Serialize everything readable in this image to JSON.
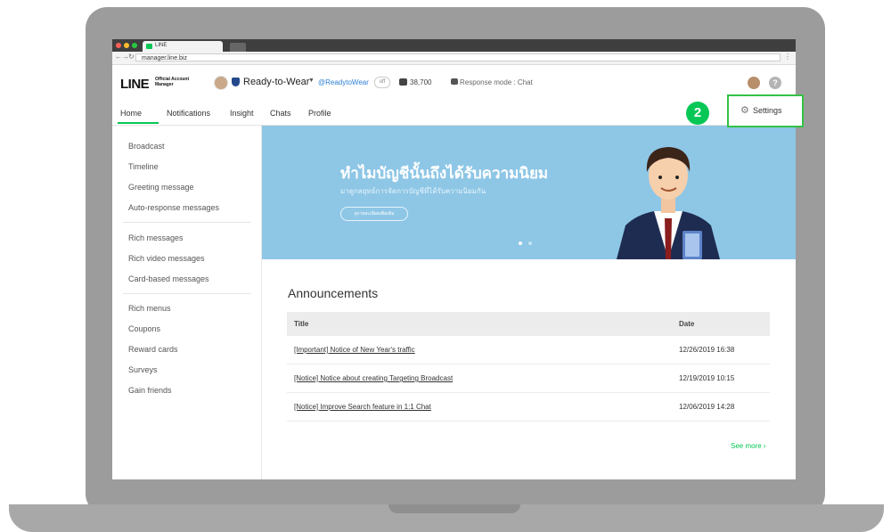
{
  "browser": {
    "tab_title": "LINE",
    "url": "manager.line.biz"
  },
  "header": {
    "logo": "LINE",
    "logo_sub": "Official Account Manager",
    "account_name": "Ready-to-Wear",
    "account_id": "@ReadytoWear",
    "account_pill": "off",
    "friends_count": "38,700",
    "response_mode": "Response mode : Chat",
    "help": "?"
  },
  "nav": {
    "home": "Home",
    "notifications": "Notifications",
    "insight": "Insight",
    "chats": "Chats",
    "profile": "Profile",
    "settings": "Settings"
  },
  "callout": {
    "step": "2"
  },
  "sidebar": {
    "items": [
      "Broadcast",
      "Timeline",
      "Greeting message",
      "Auto-response messages",
      "Rich messages",
      "Rich video messages",
      "Card-based messages",
      "Rich menus",
      "Coupons",
      "Reward cards",
      "Surveys",
      "Gain friends"
    ]
  },
  "banner": {
    "title": "ทำไมบัญชีนั้นถึงได้รับความนิยม",
    "subtitle": "มาดูกลยุทธ์การจัดการบัญชีที่ได้รับความนิยมกัน",
    "button": "ดูรายละเอียดเพิ่มเติม"
  },
  "announcements": {
    "heading": "Announcements",
    "col_title": "Title",
    "col_date": "Date",
    "rows": [
      {
        "title": "[Important] Notice of New Year's traffic",
        "date": "12/26/2019 16:38"
      },
      {
        "title": "[Notice] Notice about creating Targeting Broadcast",
        "date": "12/19/2019 10:15"
      },
      {
        "title": "[Notice] Improve Search feature in 1:1 Chat",
        "date": "12/06/2019 14:28"
      }
    ],
    "see_more": "See more"
  },
  "colors": {
    "brand_green": "#06c755",
    "banner_bg": "#8ec6e6",
    "callout_border": "#34c246"
  }
}
